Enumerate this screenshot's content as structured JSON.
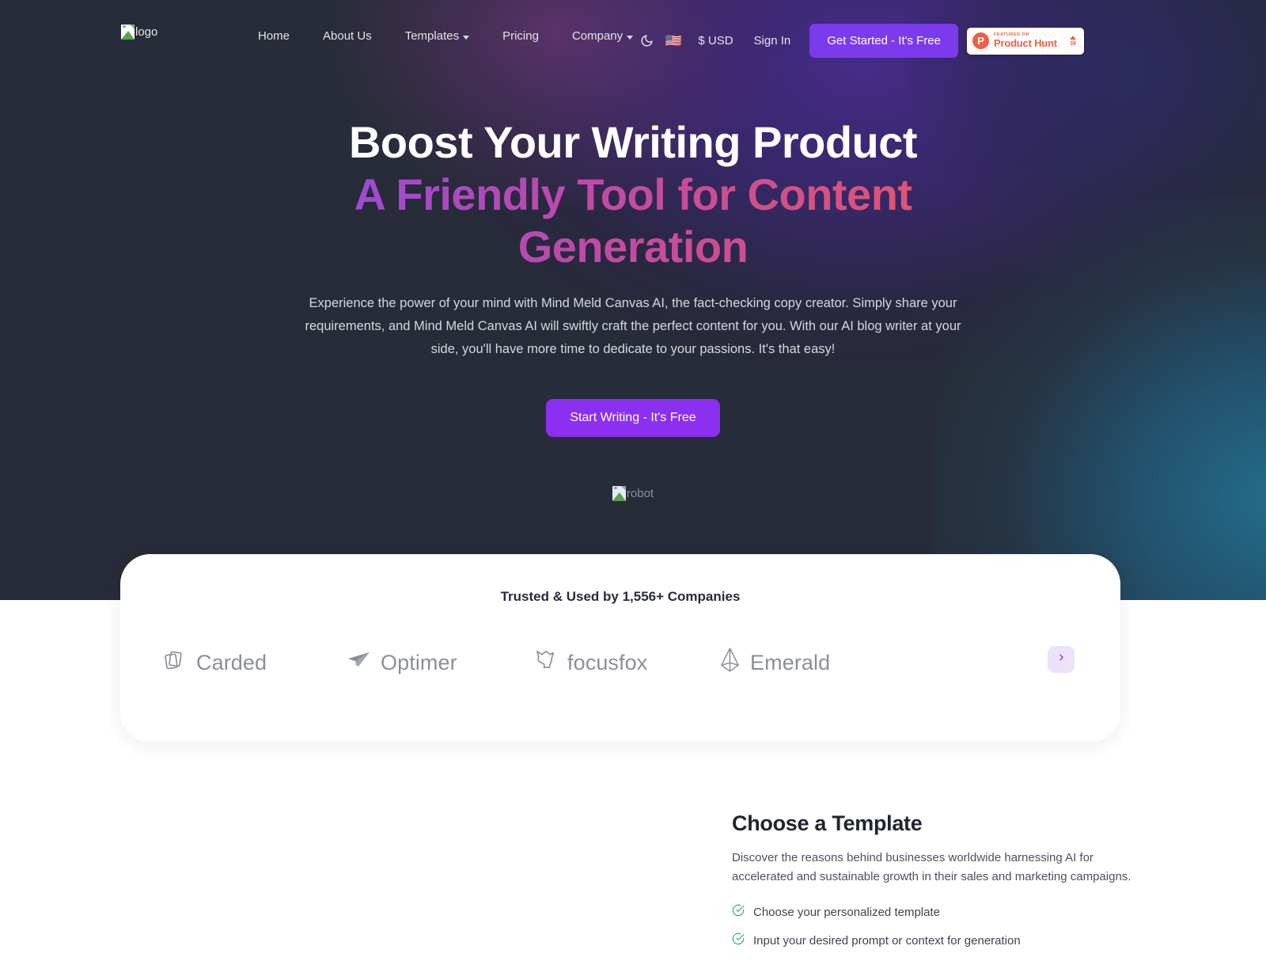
{
  "navbar": {
    "logo_alt": "logo",
    "links": [
      {
        "label": "Home",
        "has_caret": false
      },
      {
        "label": "About Us",
        "has_caret": false
      },
      {
        "label": "Templates",
        "has_caret": true
      },
      {
        "label": "Pricing",
        "has_caret": false
      },
      {
        "label": "Company",
        "has_caret": true
      }
    ],
    "dark_mode_icon": "moon-icon",
    "language_flag": "🇺🇸",
    "currency": "$ USD",
    "signin_label": "Sign In",
    "get_started_label": "Get Started - It's Free",
    "product_hunt": {
      "featured_label": "FEATURED ON",
      "name": "Product Hunt",
      "upvotes": "38",
      "logo_letter": "P"
    }
  },
  "hero": {
    "headline_line1": "Boost Your Writing Product",
    "headline_line2": "A Friendly Tool for Content Generation",
    "subcopy": "Experience the power of your mind with Mind Meld Canvas AI, the fact-checking copy creator. Simply share your requirements, and Mind Meld Canvas AI will swiftly craft the perfect content for you. With our AI blog writer at your side, you'll have more time to dedicate to your passions. It's that easy!",
    "cta_label": "Start Writing - It's Free",
    "robot_alt": "robot"
  },
  "trusted": {
    "title": "Trusted & Used by 1,556+ Companies",
    "logos": [
      {
        "name": "Carded",
        "icon": "cards-icon"
      },
      {
        "name": "Optimer",
        "icon": "paper-plane-icon"
      },
      {
        "name": "focusfox",
        "icon": "fox-icon"
      },
      {
        "name": "Emerald",
        "icon": "gem-icon"
      }
    ],
    "next_icon": "chevron-right-icon"
  },
  "template": {
    "title": "Choose a Template",
    "description": "Discover the reasons behind businesses worldwide harnessing AI for accelerated and sustainable growth in their sales and marketing campaigns.",
    "features": [
      "Choose your personalized template",
      "Input your desired prompt or context for generation"
    ]
  },
  "colors": {
    "accent_purple": "#8b2ff0",
    "nav_button_purple": "#7c3aed",
    "hero_bg": "#272c38",
    "product_hunt_red": "#ef5f45",
    "check_green": "#4caf7d",
    "carousel_bg": "#ece2fa"
  }
}
